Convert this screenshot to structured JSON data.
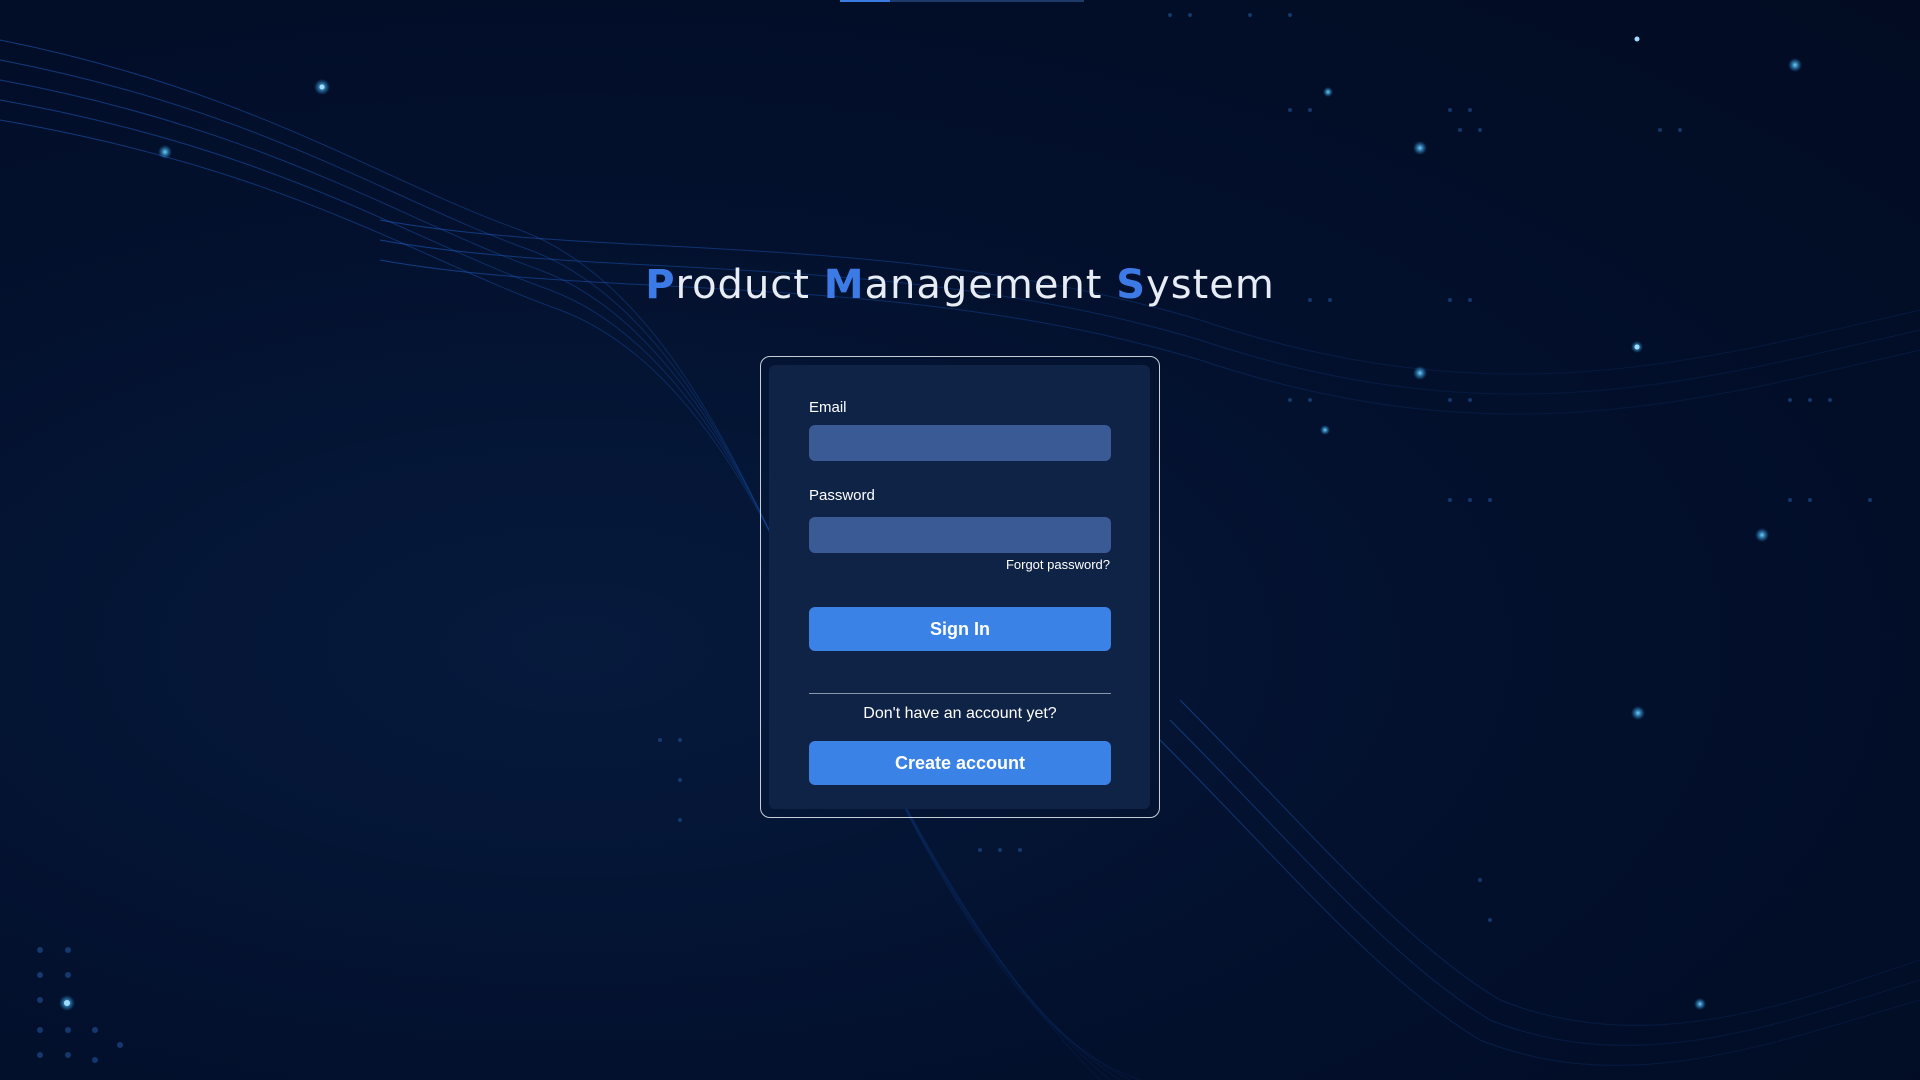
{
  "title": {
    "word1_cap": "P",
    "word1_rest": "roduct ",
    "word2_cap": "M",
    "word2_rest": "anagement ",
    "word3_cap": "S",
    "word3_rest": "ystem"
  },
  "form": {
    "email_label": "Email",
    "email_value": "",
    "password_label": "Password",
    "password_value": "",
    "forgot_label": "Forgot password?",
    "signin_label": "Sign In",
    "signup_prompt": "Don't have an account yet?",
    "create_label": "Create account"
  },
  "colors": {
    "accent": "#3a82e6",
    "background": "#03112e",
    "card": "#0f2347",
    "input": "#3a5a96"
  }
}
